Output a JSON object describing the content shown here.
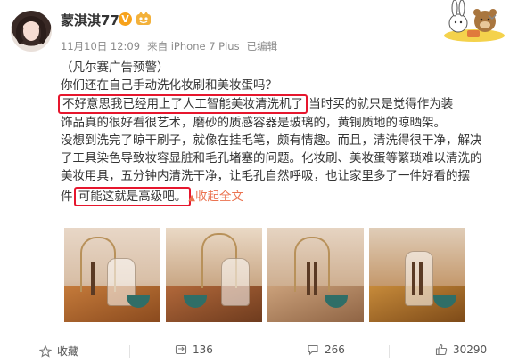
{
  "post": {
    "author": "蒙淇淇77",
    "verified_badge": "V",
    "fan_badge_icon": "fan-badge-icon",
    "date": "11月10日 12:09",
    "source": "来自 iPhone 7 Plus",
    "edited": "已编辑",
    "lines": [
      {
        "before": "（凡尔赛广告预警）",
        "highlight": "",
        "after": ""
      },
      {
        "before": "你们还在自己手动洗化妆刷和美妆蛋吗？",
        "highlight": "",
        "after": ""
      },
      {
        "before": "",
        "highlight": "不好意思我已经用上了人工智能美妆清洗机了",
        "after": "  当时买的就只是觉得作为装"
      },
      {
        "before": "饰品真的很好看很艺术，磨砂的质感容器是玻璃的，黄铜质地的晾晒架。",
        "highlight": "",
        "after": ""
      },
      {
        "before": "没想到洗完了晾干刷子，就像在挂毛笔，颇有情趣。而且，清洗得很干净，解决",
        "highlight": "",
        "after": ""
      },
      {
        "before": "了工具染色导致妆容显脏和毛孔堵塞的问题。化妆刷、美妆蛋等繁琐难以清洗的",
        "highlight": "",
        "after": ""
      },
      {
        "before": "美妆用具，五分钟内清洗干净，让毛孔自然呼吸，也让家里多了一件好看的摆",
        "highlight": "",
        "after": ""
      },
      {
        "before": "件 ",
        "highlight": "可能这就是高级吧。",
        "after": ""
      }
    ],
    "collapse_label": "收起全文",
    "collapse_icon": "chevron-up-icon"
  },
  "photos": [
    {
      "label": "photo-1"
    },
    {
      "label": "photo-2"
    },
    {
      "label": "photo-3"
    },
    {
      "label": "photo-4"
    }
  ],
  "actions": {
    "favorite": {
      "icon": "star-icon",
      "label": "收藏"
    },
    "repost": {
      "icon": "repost-icon",
      "count": "136"
    },
    "comment": {
      "icon": "comment-icon",
      "count": "266"
    },
    "like": {
      "icon": "thumbs-up-icon",
      "count": "30290"
    }
  },
  "colors": {
    "highlight_border": "#e6162d",
    "link": "#eb7350",
    "badge": "#f7a21b"
  }
}
